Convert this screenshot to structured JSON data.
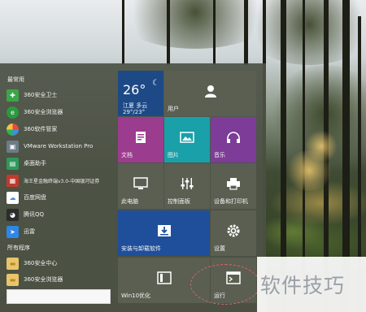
{
  "start_menu": {
    "recent_label": "最常用",
    "recent_apps": [
      {
        "label": "360安全卫士",
        "icon": "360-security-icon",
        "color": "#3aa64a",
        "glyph": "✚"
      },
      {
        "label": "360安全浏览器",
        "icon": "360-browser-icon",
        "color": "#2b9a3e",
        "glyph": "e"
      },
      {
        "label": "360软件管家",
        "icon": "360-software-manager-icon",
        "color": "#3d8fe0",
        "glyph": "◉"
      },
      {
        "label": "VMware Workstation Pro",
        "icon": "vmware-icon",
        "color": "#6e7c88",
        "glyph": "▣"
      },
      {
        "label": "桌面助手",
        "icon": "desktop-assistant-icon",
        "color": "#2e9a5c",
        "glyph": "▤"
      },
      {
        "label": "海王星金融终端v3.0-中国银河证券",
        "icon": "neptune-terminal-icon",
        "color": "#c23a2c",
        "glyph": "▦"
      },
      {
        "label": "百度网盘",
        "icon": "baidu-netdisk-icon",
        "color": "#3f8ee8",
        "glyph": "☁"
      },
      {
        "label": "腾讯QQ",
        "icon": "qq-icon",
        "color": "#2c2c2c",
        "glyph": "◕"
      },
      {
        "label": "迅雷",
        "icon": "thunder-icon",
        "color": "#2f86e8",
        "glyph": "➤"
      }
    ],
    "all_programs_label": "所有程序",
    "folder_apps": [
      {
        "label": "360安全中心",
        "icon": "folder-icon",
        "color": "#e9c46a",
        "glyph": "▬"
      },
      {
        "label": "360安全浏览器",
        "icon": "folder-icon",
        "color": "#e9c46a",
        "glyph": "▬"
      }
    ],
    "search": {
      "value": ""
    }
  },
  "tiles": {
    "weather": {
      "temp": "26°",
      "moon": "☾",
      "city": "江夏 多云",
      "range": "29°/23°",
      "color": "#1d4a86"
    },
    "user": {
      "label": "用户",
      "color": "#5a5f52"
    },
    "documents": {
      "label": "文档",
      "color": "#9b3c8e"
    },
    "pictures": {
      "label": "图片",
      "color": "#1aa0a8"
    },
    "music": {
      "label": "音乐",
      "color": "#7d3c98"
    },
    "this_pc": {
      "label": "此电脑",
      "color": "#5a5f52"
    },
    "control_panel": {
      "label": "控制面板",
      "color": "#5a5f52"
    },
    "devices_printers": {
      "label": "设备和打印机",
      "color": "#5a5f52"
    },
    "install_uninstall": {
      "label": "安装与卸载软件",
      "color": "#1f4f9a"
    },
    "settings": {
      "label": "设置",
      "color": "#5a5f52"
    },
    "win10_optimize": {
      "label": "Win10优化",
      "color": "#5a5f52"
    },
    "run": {
      "label": "运行",
      "color": "#5a5f52"
    }
  },
  "watermark": {
    "text": "软件技巧"
  }
}
